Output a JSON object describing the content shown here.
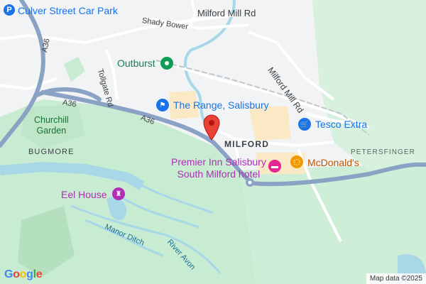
{
  "map": {
    "labels": {
      "car_park": "Culver Street Car Park",
      "milford_mill_rd_top": "Milford Mill Rd",
      "shady_bower": "Shady Bower",
      "milford_mill_rd_diag": "Milford Mill Rd",
      "outburst": "Outburst",
      "tollgate_rd": "Tollgate Rd",
      "the_range": "The Range, Salisbury",
      "tesco": "Tesco Extra",
      "milford": "MILFORD",
      "petersfinger": "PETERSFINGER",
      "premier_inn_line1": "Premier Inn Salisbury",
      "premier_inn_line2": "South Milford hotel",
      "mcdonalds": "McDonald's",
      "churchill_garden_line1": "Churchill",
      "churchill_garden_line2": "Garden",
      "bugmore": "BUGMORE",
      "eel_house": "Eel House",
      "manor_ditch": "Manor Ditch",
      "river_avon": "River Avon",
      "a36_left": "A36",
      "a36_mid1": "A36",
      "a36_mid2": "A36"
    },
    "icons": {
      "parking": "P",
      "outburst": "shop-pin-icon",
      "the_range": "shopping-bag-icon",
      "tesco": "shopping-cart-icon",
      "premier_inn": "hotel-bed-icon",
      "mcdonalds": "restaurant-icon",
      "eel_house": "castle-icon",
      "location": "red-map-pin-icon"
    },
    "colors": {
      "land": "#f1f3f4",
      "park": "#c8ecd2",
      "water": "#a8d7e8",
      "major_road": "#8aa2c4",
      "minor_road": "#ffffff",
      "pin": "#ea4335",
      "shopping": "#1a73e8",
      "hotel": "#e52592",
      "food": "#f29900",
      "nature": "#0f9d58"
    },
    "attribution": "Map data ©2025",
    "logo_letters": [
      "G",
      "o",
      "o",
      "g",
      "l",
      "e"
    ]
  }
}
